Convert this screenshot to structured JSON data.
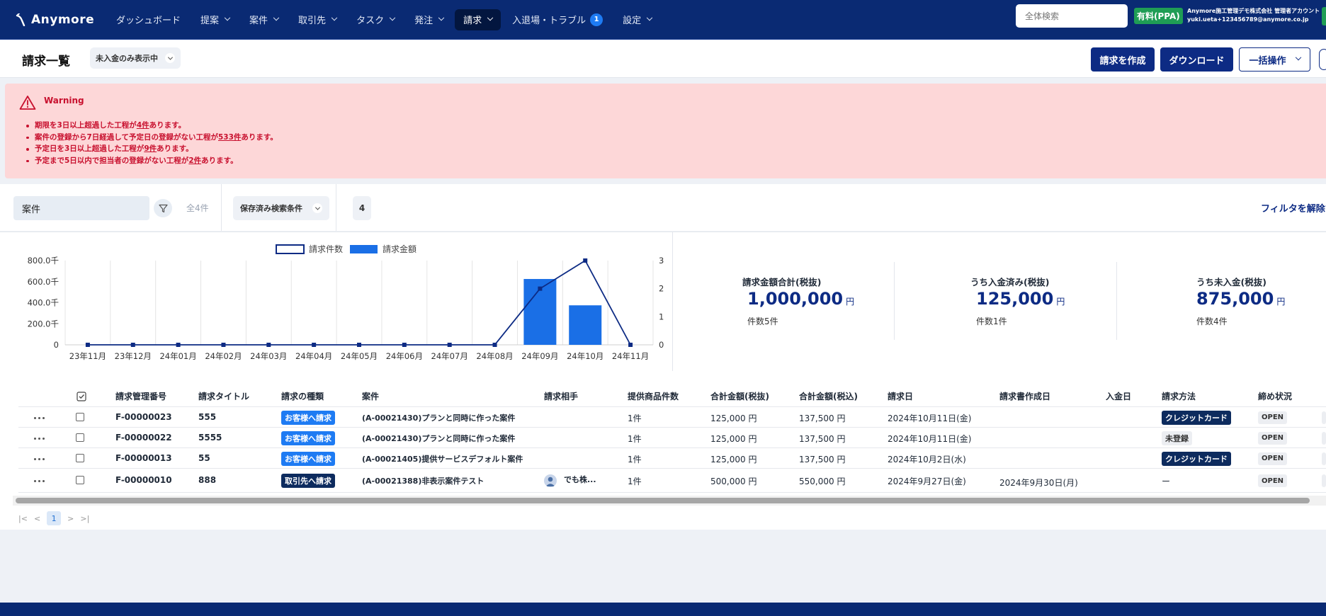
{
  "header": {
    "logo_text": "Anymore",
    "nav": [
      {
        "label": "ダッシュボード",
        "dropdown": false,
        "active": false
      },
      {
        "label": "提案",
        "dropdown": true,
        "active": false
      },
      {
        "label": "案件",
        "dropdown": true,
        "active": false
      },
      {
        "label": "取引先",
        "dropdown": true,
        "active": false
      },
      {
        "label": "タスク",
        "dropdown": true,
        "active": false
      },
      {
        "label": "発注",
        "dropdown": true,
        "active": false
      },
      {
        "label": "請求",
        "dropdown": true,
        "active": true
      },
      {
        "label": "入退場・トラブル",
        "dropdown": false,
        "active": false,
        "badge": "1"
      },
      {
        "label": "設定",
        "dropdown": true,
        "active": false
      }
    ],
    "search_placeholder": "全体検索",
    "plan_badge": "有料(PPA)",
    "account_line1": "Anymore施工管理デモ株式会社 管理者アカウント",
    "account_line2": "yuki.ueta+123456789@anymore.co.jp"
  },
  "page": {
    "title": "請求一覧",
    "filter_pill": "未入金のみ表示中",
    "buttons": {
      "create": "請求を作成",
      "download": "ダウンロード",
      "bulk": "一括操作"
    }
  },
  "warning": {
    "title": "Warning",
    "items": [
      {
        "before": "期限を3日以上超過した工程が",
        "link": "4件",
        "after": "あります。"
      },
      {
        "before": "案件の登録から7日経過して予定日の登録がない工程が",
        "link": "533件",
        "after": "あります。"
      },
      {
        "before": "予定日を3日以上超過した工程が",
        "link": "9件",
        "after": "あります。"
      },
      {
        "before": "予定まで5日以内で担当者の登録がない工程が",
        "link": "2件",
        "after": "あります。"
      }
    ]
  },
  "filters": {
    "case_input": "案件",
    "total_count": "全4件",
    "saved_search": "保存済み検索条件",
    "count": "4",
    "clear": "フィルタを解除す"
  },
  "chart_data": {
    "type": "bar",
    "categories": [
      "23年11月",
      "23年12月",
      "24年01月",
      "24年02月",
      "24年03月",
      "24年04月",
      "24年05月",
      "24年06月",
      "24年07月",
      "24年08月",
      "24年09月",
      "24年10月",
      "24年11月"
    ],
    "series": [
      {
        "name": "請求件数",
        "kind": "line",
        "axis": "right",
        "values": [
          0,
          0,
          0,
          0,
          0,
          0,
          0,
          0,
          0,
          0,
          2,
          3,
          0
        ]
      },
      {
        "name": "請求金額",
        "kind": "bar",
        "axis": "left",
        "values": [
          0,
          0,
          0,
          0,
          0,
          0,
          0,
          0,
          0,
          0,
          625000,
          375000,
          0
        ]
      }
    ],
    "left_ticks": [
      "800.0千",
      "600.0千",
      "400.0千",
      "200.0千",
      "0"
    ],
    "right_ticks": [
      "3",
      "2",
      "1",
      "0"
    ],
    "ylim_left": [
      0,
      800000
    ],
    "ylim_right": [
      0,
      3
    ],
    "legend_position": "top-center",
    "colors": {
      "line": "#0d2b84",
      "bar": "#1a6fe6"
    }
  },
  "summary": [
    {
      "label": "請求金額合計(税抜)",
      "value": "1,000,000",
      "unit": "円",
      "count": "件数5件"
    },
    {
      "label": "うち入金済み(税抜)",
      "value": "125,000",
      "unit": "円",
      "count": "件数1件"
    },
    {
      "label": "うち未入金(税抜)",
      "value": "875,000",
      "unit": "円",
      "count": "件数4件"
    }
  ],
  "table": {
    "headers": [
      "請求管理番号",
      "請求タイトル",
      "請求の種類",
      "案件",
      "請求相手",
      "提供商品件数",
      "合計金額(税抜)",
      "合計金額(税込)",
      "請求日",
      "請求書作成日",
      "入金日",
      "請求方法",
      "締め状況"
    ],
    "rows": [
      {
        "id": "F-00000023",
        "title": "555",
        "type": "お客様へ請求",
        "type_style": "blue",
        "case": "(A-00021430)プランと同時に作った案件",
        "partner": "",
        "items": "1件",
        "amount_ex": "125,000 円",
        "amount_in": "137,500 円",
        "date": "2024年10月11日(金)",
        "created": "",
        "paid": "",
        "method": "クレジットカード",
        "method_style": "navy",
        "status": "OPEN"
      },
      {
        "id": "F-00000022",
        "title": "5555",
        "type": "お客様へ請求",
        "type_style": "blue",
        "case": "(A-00021430)プランと同時に作った案件",
        "partner": "",
        "items": "1件",
        "amount_ex": "125,000 円",
        "amount_in": "137,500 円",
        "date": "2024年10月11日(金)",
        "created": "",
        "paid": "",
        "method": "未登録",
        "method_style": "gray",
        "status": "OPEN"
      },
      {
        "id": "F-00000013",
        "title": "55",
        "type": "お客様へ請求",
        "type_style": "blue",
        "case": "(A-00021405)提供サービスデフォルト案件",
        "partner": "",
        "items": "1件",
        "amount_ex": "125,000 円",
        "amount_in": "137,500 円",
        "date": "2024年10月2日(水)",
        "created": "",
        "paid": "",
        "method": "クレジットカード",
        "method_style": "navy",
        "status": "OPEN"
      },
      {
        "id": "F-00000010",
        "title": "888",
        "type": "取引先へ請求",
        "type_style": "navy",
        "case": "(A-00021388)非表示案件テスト",
        "partner": "でも株...",
        "items": "1件",
        "amount_ex": "500,000 円",
        "amount_in": "550,000 円",
        "date": "2024年9月27日(金)",
        "created": "2024年9月30日(月)",
        "paid": "",
        "method": "ー",
        "method_style": "text",
        "status": "OPEN"
      }
    ]
  },
  "pagination": {
    "current": "1"
  }
}
